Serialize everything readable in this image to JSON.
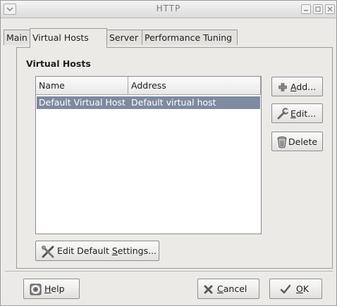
{
  "window": {
    "title": "HTTP"
  },
  "tabs": [
    {
      "label": "Main"
    },
    {
      "label": "Virtual Hosts"
    },
    {
      "label": "Server"
    },
    {
      "label": "Performance Tuning"
    }
  ],
  "section": {
    "title": "Virtual Hosts"
  },
  "table": {
    "columns": [
      "Name",
      "Address"
    ],
    "rows": [
      {
        "name": "Default Virtual Host",
        "address": "Default virtual host"
      }
    ]
  },
  "side_buttons": {
    "add": {
      "pre": "",
      "key": "A",
      "post": "dd..."
    },
    "edit": {
      "pre": "",
      "key": "E",
      "post": "dit..."
    },
    "delete": {
      "label": "Delete"
    }
  },
  "edit_default": {
    "pre": "Edit Default ",
    "key": "S",
    "post": "ettings..."
  },
  "footer": {
    "help": {
      "pre": "",
      "key": "H",
      "post": "elp"
    },
    "cancel": {
      "pre": "",
      "key": "C",
      "post": "ancel"
    },
    "ok": {
      "pre": "",
      "key": "O",
      "post": "K"
    }
  },
  "icons": {
    "add": "plus-icon",
    "edit": "wrench-icon",
    "delete": "trash-icon",
    "settings": "tools-icon",
    "help": "lifebuoy-icon",
    "cancel": "cross-icon",
    "ok": "checkmark-icon"
  }
}
